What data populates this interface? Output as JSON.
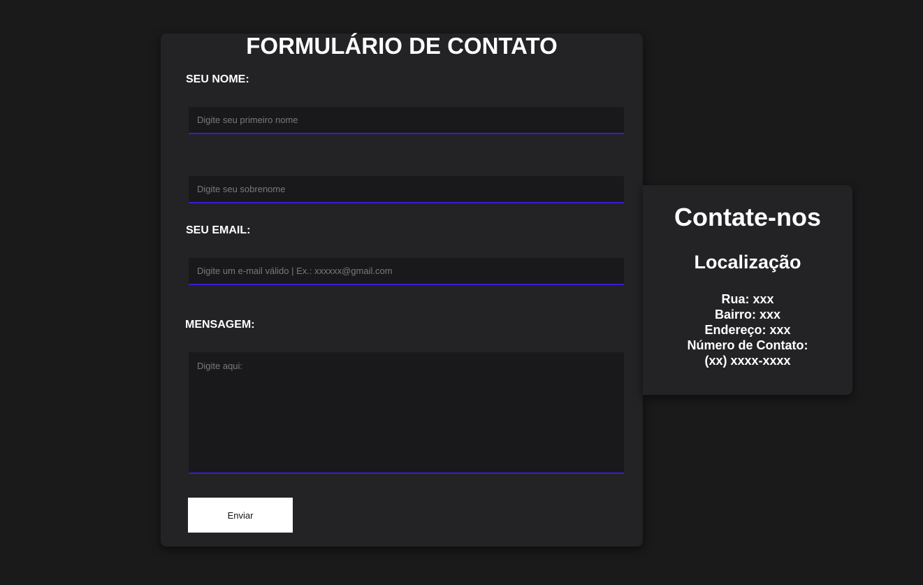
{
  "form": {
    "title": "FORMULÁRIO DE CONTATO",
    "name_label": "SEU NOME:",
    "first_name_placeholder": "Digite seu primeiro nome",
    "last_name_placeholder": "Digite seu sobrenome",
    "email_label": "SEU EMAIL:",
    "email_placeholder": "Digite um e-mail válido | Ex.: xxxxxx@gmail.com",
    "message_label": "MENSAGEM:",
    "message_placeholder": "Digite aqui:",
    "submit_label": "Enviar"
  },
  "contact": {
    "title": "Contate-nos",
    "subtitle": "Localização",
    "lines": [
      "Rua: xxx",
      "Bairro: xxx",
      "Endereço: xxx",
      "Número de Contato:",
      "(xx) xxxx-xxxx"
    ]
  },
  "colors": {
    "background": "#1b1a1b",
    "card": "#232224",
    "field": "#19181a",
    "accent": "#3a1bd6",
    "text": "#ffffff"
  }
}
